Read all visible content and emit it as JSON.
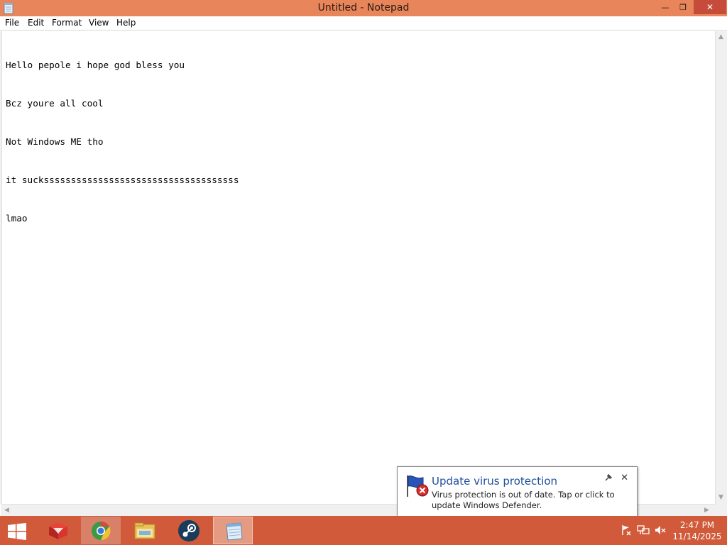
{
  "window": {
    "title": "Untitled - Notepad",
    "controls": {
      "minimize": "—",
      "restore": "❐",
      "close": "✕"
    }
  },
  "menu": [
    "File",
    "Edit",
    "Format",
    "View",
    "Help"
  ],
  "editor": {
    "lines": [
      "Hello pepole i hope god bless you",
      "Bcz youre all cool",
      "Not Windows ME tho",
      "it suckssssssssssssssssssssssssssssssssssss",
      "lmao"
    ]
  },
  "notification": {
    "title": "Update virus protection",
    "body": "Virus protection is out of date. Tap or click to update Windows Defender.",
    "close": "✕"
  },
  "taskbar": {
    "apps": [
      "start-icon",
      "app-icon",
      "chrome-icon",
      "file-explorer-icon",
      "steam-icon",
      "notepad-icon"
    ]
  },
  "tray": {
    "time": "2:47 PM",
    "date": "11/14/2025"
  },
  "colors": {
    "titlebar": "#e8855a",
    "taskbar": "#d05a3a",
    "accent_link": "#1f4e9c"
  }
}
